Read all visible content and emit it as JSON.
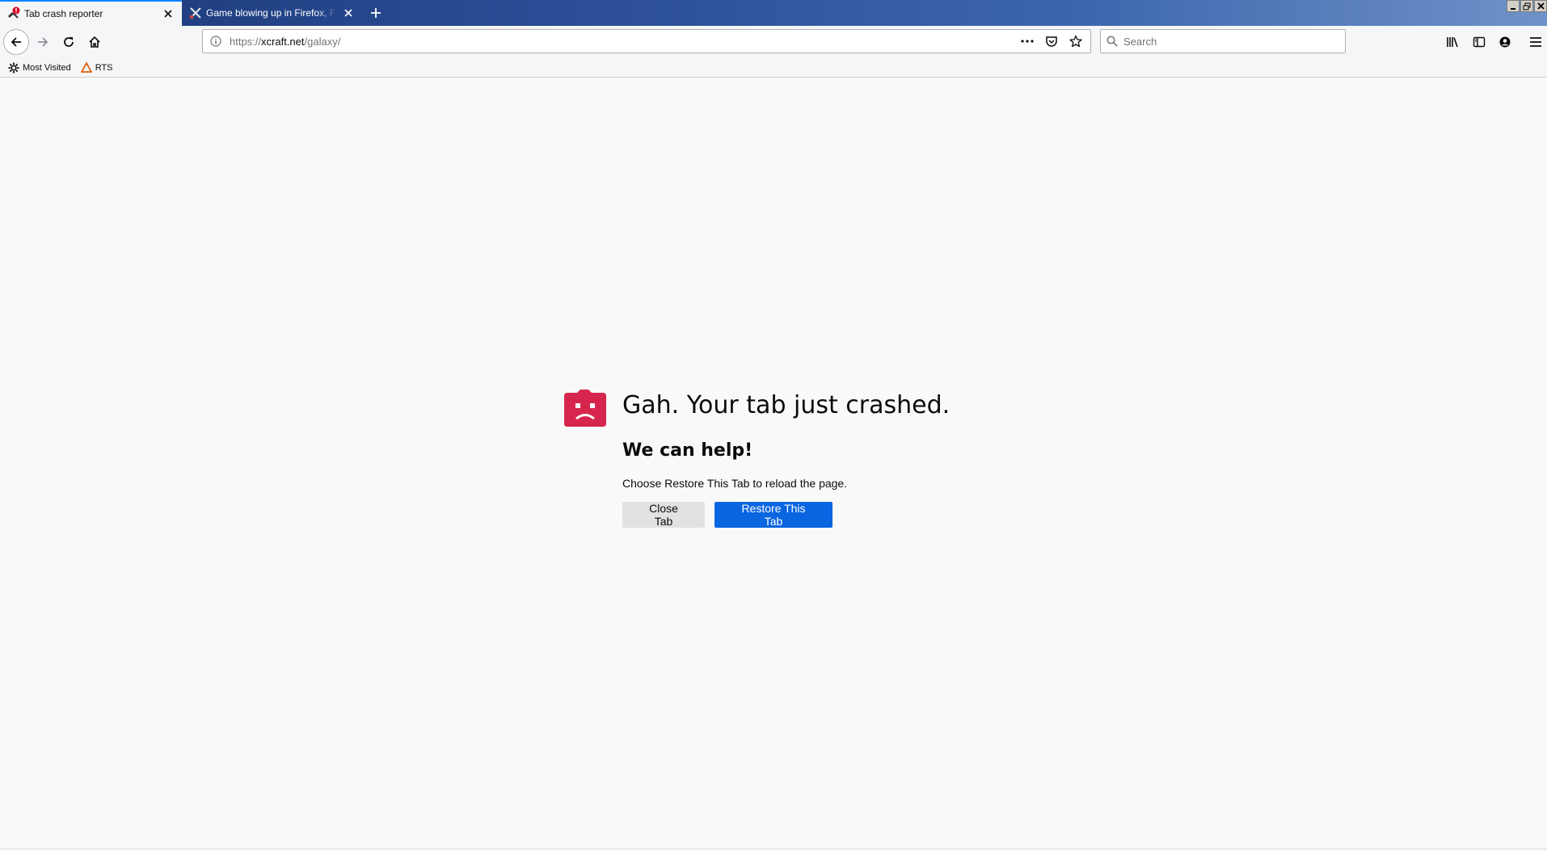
{
  "browser": {
    "tabs": [
      {
        "title": "Tab crash reporter",
        "active": true
      },
      {
        "title": "Game blowing up in Firefox, Firefo",
        "active": false
      }
    ],
    "new_tab_label": "+",
    "url": {
      "scheme_host": "https://",
      "domain": "xcraft.net",
      "path": "/galaxy/"
    },
    "search": {
      "placeholder": "Search"
    },
    "bookmarks": [
      {
        "label": "Most Visited",
        "icon": "gear-icon"
      },
      {
        "label": "RTS",
        "icon": "warning-triangle-icon"
      }
    ]
  },
  "crash_page": {
    "title": "Gah. Your tab just crashed.",
    "subtitle": "We can help!",
    "message": "Choose Restore This Tab to reload the page.",
    "close_button": "Close Tab",
    "restore_button": "Restore This Tab"
  },
  "colors": {
    "accent": "#0a84ff",
    "primary_button": "#0a65e0",
    "crash_icon": "#d7264e"
  }
}
